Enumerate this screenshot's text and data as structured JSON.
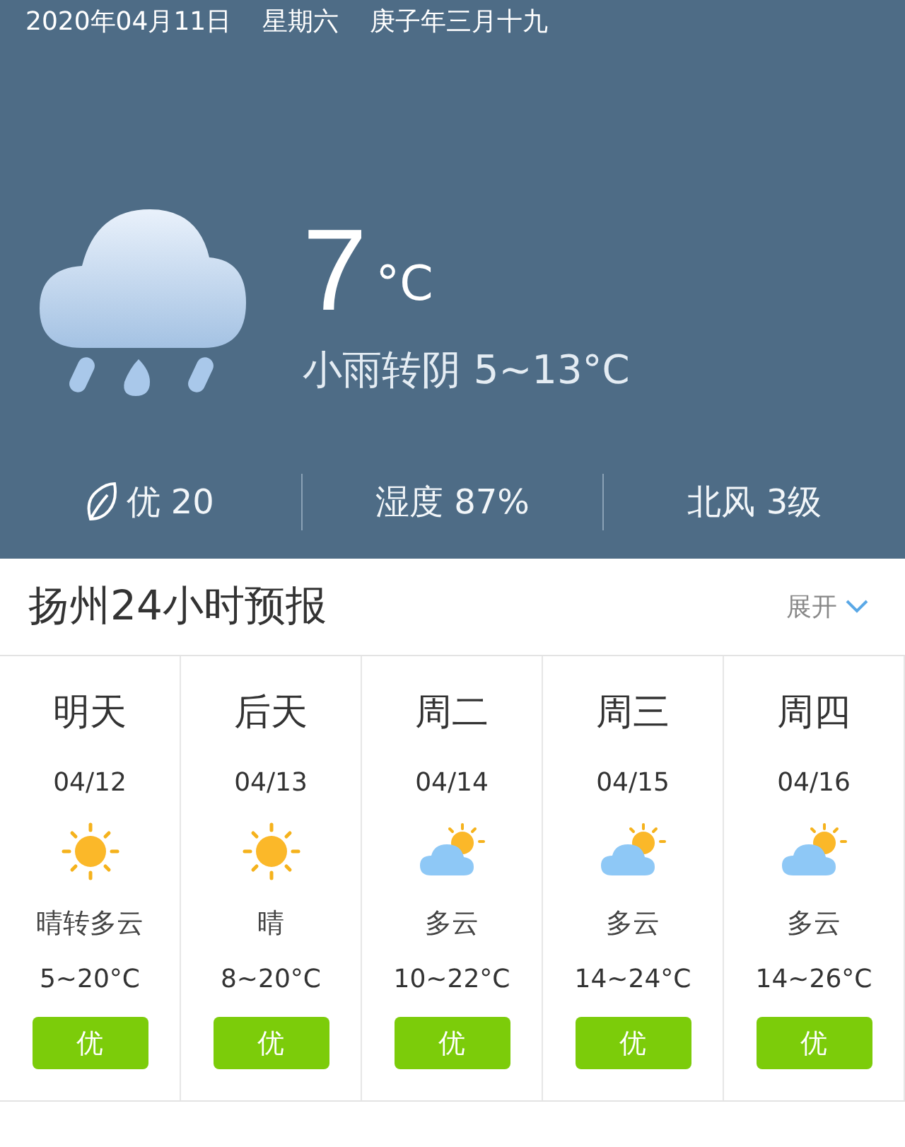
{
  "header": {
    "date": "2020年04月11日",
    "weekday": "星期六",
    "lunar_date": "庚子年三月十九"
  },
  "current": {
    "kind": "rain",
    "temperature": "7",
    "unit": "°C",
    "description": "小雨转阴 5~13°C"
  },
  "stats": [
    {
      "kind": "air",
      "text": "优 20"
    },
    {
      "kind": "plain",
      "text": "湿度 87%"
    },
    {
      "kind": "plain",
      "text": "北风 3级"
    }
  ],
  "forecast_section": {
    "title": "扬州24小时预报",
    "expand_label": "展开"
  },
  "days": [
    {
      "day": "明天",
      "date": "04/12",
      "kind": "sunny",
      "weather": "晴转多云",
      "temps": "5~20°C",
      "aqi": "优",
      "color": "#7ccc0a"
    },
    {
      "day": "后天",
      "date": "04/13",
      "kind": "sunny",
      "weather": "晴",
      "temps": "8~20°C",
      "aqi": "优",
      "color": "#7ccc0a"
    },
    {
      "day": "周二",
      "date": "04/14",
      "kind": "partly-cloudy",
      "weather": "多云",
      "temps": "10~22°C",
      "aqi": "优",
      "color": "#7ccc0a"
    },
    {
      "day": "周三",
      "date": "04/15",
      "kind": "partly-cloudy",
      "weather": "多云",
      "temps": "14~24°C",
      "aqi": "优",
      "color": "#7ccc0a"
    },
    {
      "day": "周四",
      "date": "04/16",
      "kind": "partly-cloudy",
      "weather": "多云",
      "temps": "14~26°C",
      "aqi": "优",
      "color": "#7ccc0a"
    }
  ]
}
